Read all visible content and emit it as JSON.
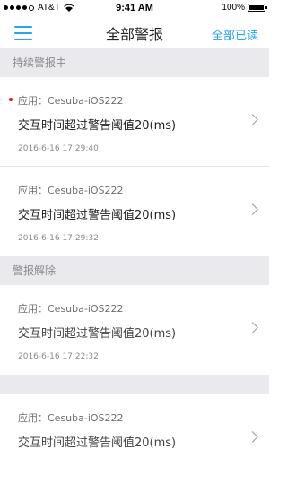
{
  "status_bar": {
    "carrier": "AT&T",
    "time": "9:41 AM",
    "battery": "100%"
  },
  "nav": {
    "title": "全部警报",
    "action": "全部已读",
    "menu_icon": "hamburger-menu-icon"
  },
  "sections": [
    {
      "header": "持续警报中",
      "items": [
        {
          "app": "应用：Cesuba-iOS222",
          "message": "交互时间超过警告阈值20(ms)",
          "time": "2016-6-16 17:29:40",
          "unread": true
        },
        {
          "app": "应用：Cesuba-iOS222",
          "message": "交互时间超过警告阈值20(ms)",
          "time": "2016-6-16 17:29:32",
          "unread": false
        }
      ]
    },
    {
      "header": "警报解除",
      "items": [
        {
          "app": "应用：Cesuba-iOS222",
          "message": "交互时间超过警告阈值20(ms)",
          "time": "2016-6-16 17:22:32",
          "unread": false
        },
        {
          "app": "应用：Cesuba-iOS222",
          "message": "交互时间超过警告阈值20(ms)",
          "time": "",
          "unread": false
        }
      ]
    }
  ],
  "colors": {
    "accent": "#2ba3ee",
    "unread_dot": "#e02020",
    "section_bg": "#e9e9ee"
  }
}
